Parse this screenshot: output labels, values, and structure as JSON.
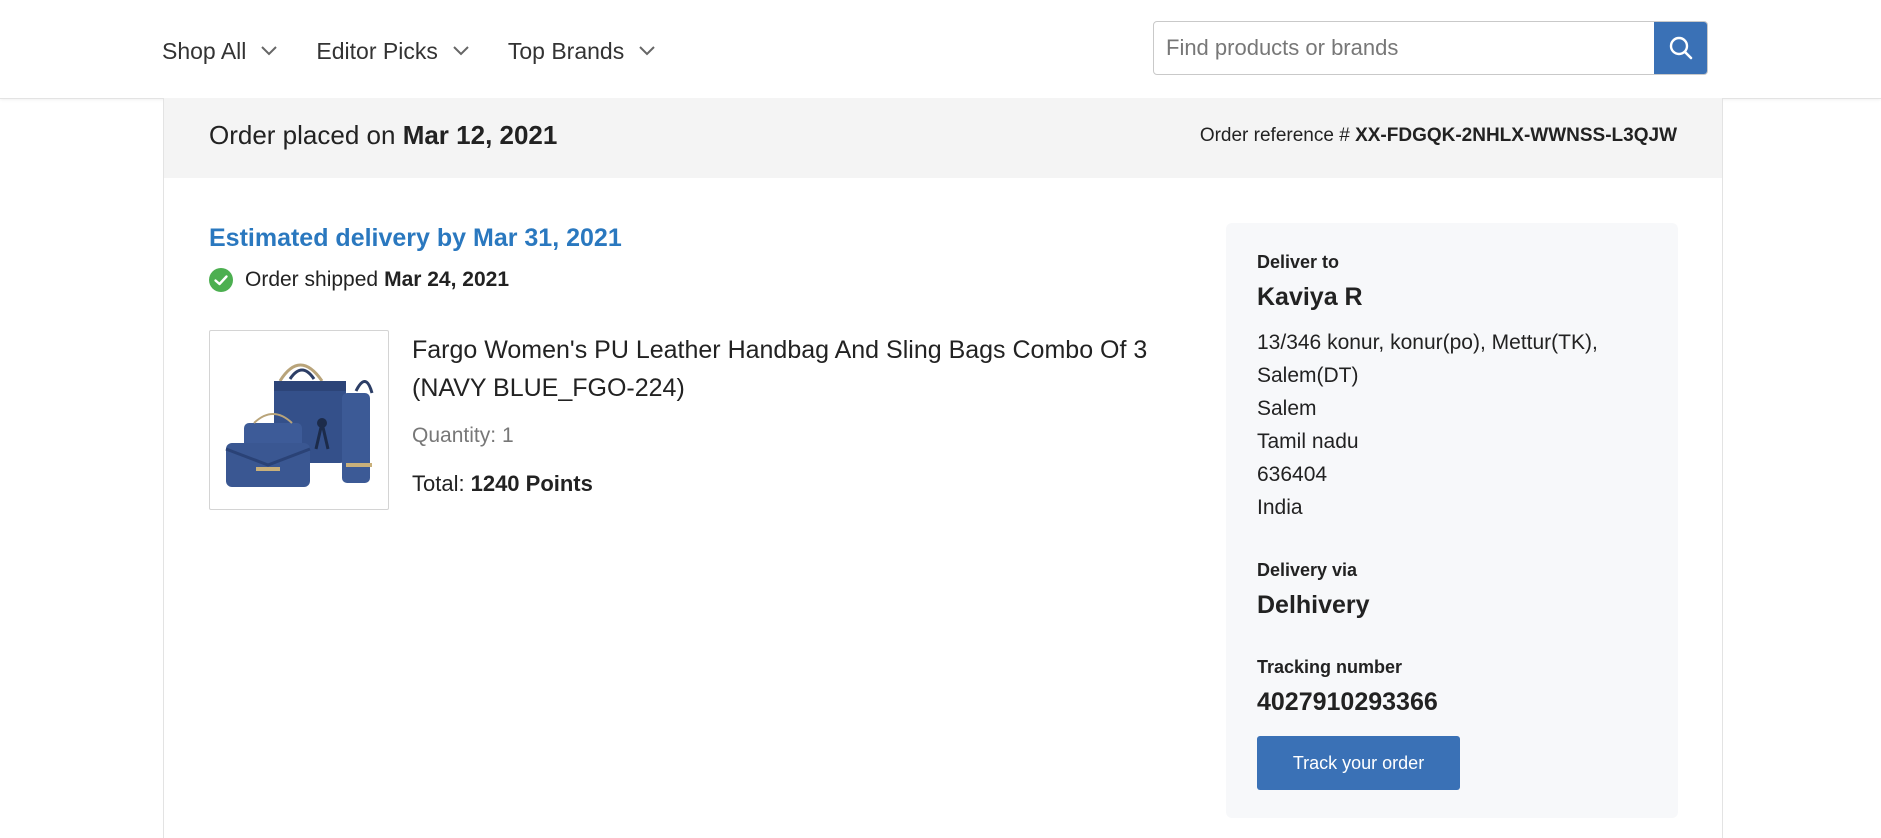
{
  "nav": {
    "items": [
      {
        "label": "Shop All"
      },
      {
        "label": "Editor Picks"
      },
      {
        "label": "Top Brands"
      }
    ]
  },
  "search": {
    "placeholder": "Find products or brands",
    "icon": "search-icon"
  },
  "order": {
    "placed_prefix": "Order placed on",
    "placed_date": "Mar 12, 2021",
    "reference_label": "Order reference #",
    "reference": "XX-FDGQK-2NHLX-WWNSS-L3QJW",
    "estimated_delivery": "Estimated delivery by Mar 31, 2021",
    "shipped_label": "Order shipped",
    "shipped_date": "Mar 24, 2021",
    "product": {
      "name": "Fargo Women's PU Leather Handbag And Sling Bags Combo Of 3 (NAVY BLUE_FGO-224)",
      "quantity_label": "Quantity:",
      "quantity": "1",
      "total_label": "Total:",
      "total": "1240 Points"
    }
  },
  "delivery": {
    "deliver_to_label": "Deliver to",
    "name": "Kaviya R",
    "address_lines": [
      "13/346 konur, konur(po), Mettur(TK),",
      "Salem(DT)",
      "Salem",
      "Tamil nadu",
      "636404",
      "India"
    ],
    "via_label": "Delivery via",
    "carrier": "Delhivery",
    "tracking_label": "Tracking number",
    "tracking_number": "4027910293366",
    "track_button": "Track your order"
  },
  "colors": {
    "accent": "#3a71b6",
    "link": "#2a78bf",
    "success": "#4caf50",
    "header_bg": "#f4f4f4",
    "panel_bg": "#f7f8fa"
  }
}
